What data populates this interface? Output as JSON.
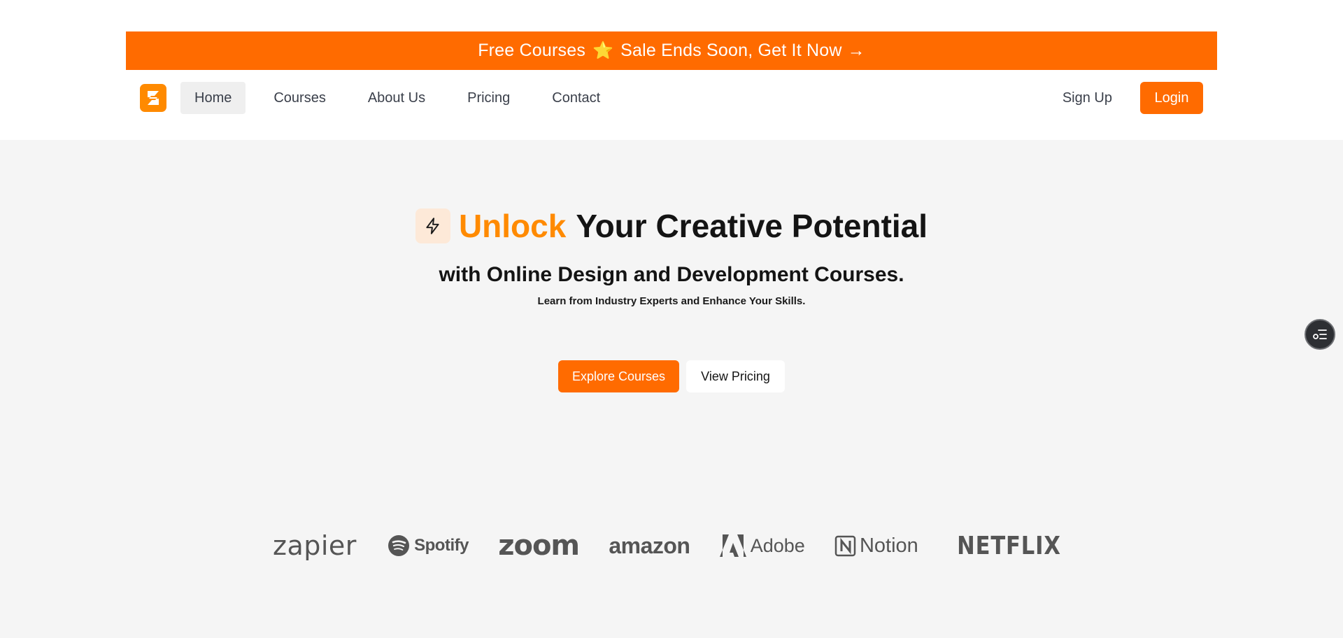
{
  "banner": {
    "text_before": "Free Courses",
    "star": "⭐",
    "text_after": "Sale Ends Soon, Get It Now",
    "arrow": "→"
  },
  "nav": {
    "items": [
      {
        "label": "Home",
        "active": true
      },
      {
        "label": "Courses",
        "active": false
      },
      {
        "label": "About Us",
        "active": false
      },
      {
        "label": "Pricing",
        "active": false
      },
      {
        "label": "Contact",
        "active": false
      }
    ],
    "signup_label": "Sign Up",
    "login_label": "Login"
  },
  "hero": {
    "headline_accent": "Unlock",
    "headline_rest": "Your Creative Potential",
    "subheadline": "with Online Design and Development Courses.",
    "tagline": "Learn from Industry Experts and Enhance Your Skills.",
    "primary_button": "Explore Courses",
    "secondary_button": "View Pricing"
  },
  "brands": [
    "zapier",
    "Spotify",
    "zoom",
    "amazon",
    "Adobe",
    "Notion",
    "NETFLIX"
  ],
  "colors": {
    "accent": "#ff6b00",
    "accent_text": "#ff8a00",
    "page_bg": "#f5f5f5",
    "brand_gray": "#555555"
  },
  "icons": {
    "logo": "brand-logo-icon",
    "bolt": "lightning-bolt-icon",
    "fab": "settings-list-icon"
  }
}
